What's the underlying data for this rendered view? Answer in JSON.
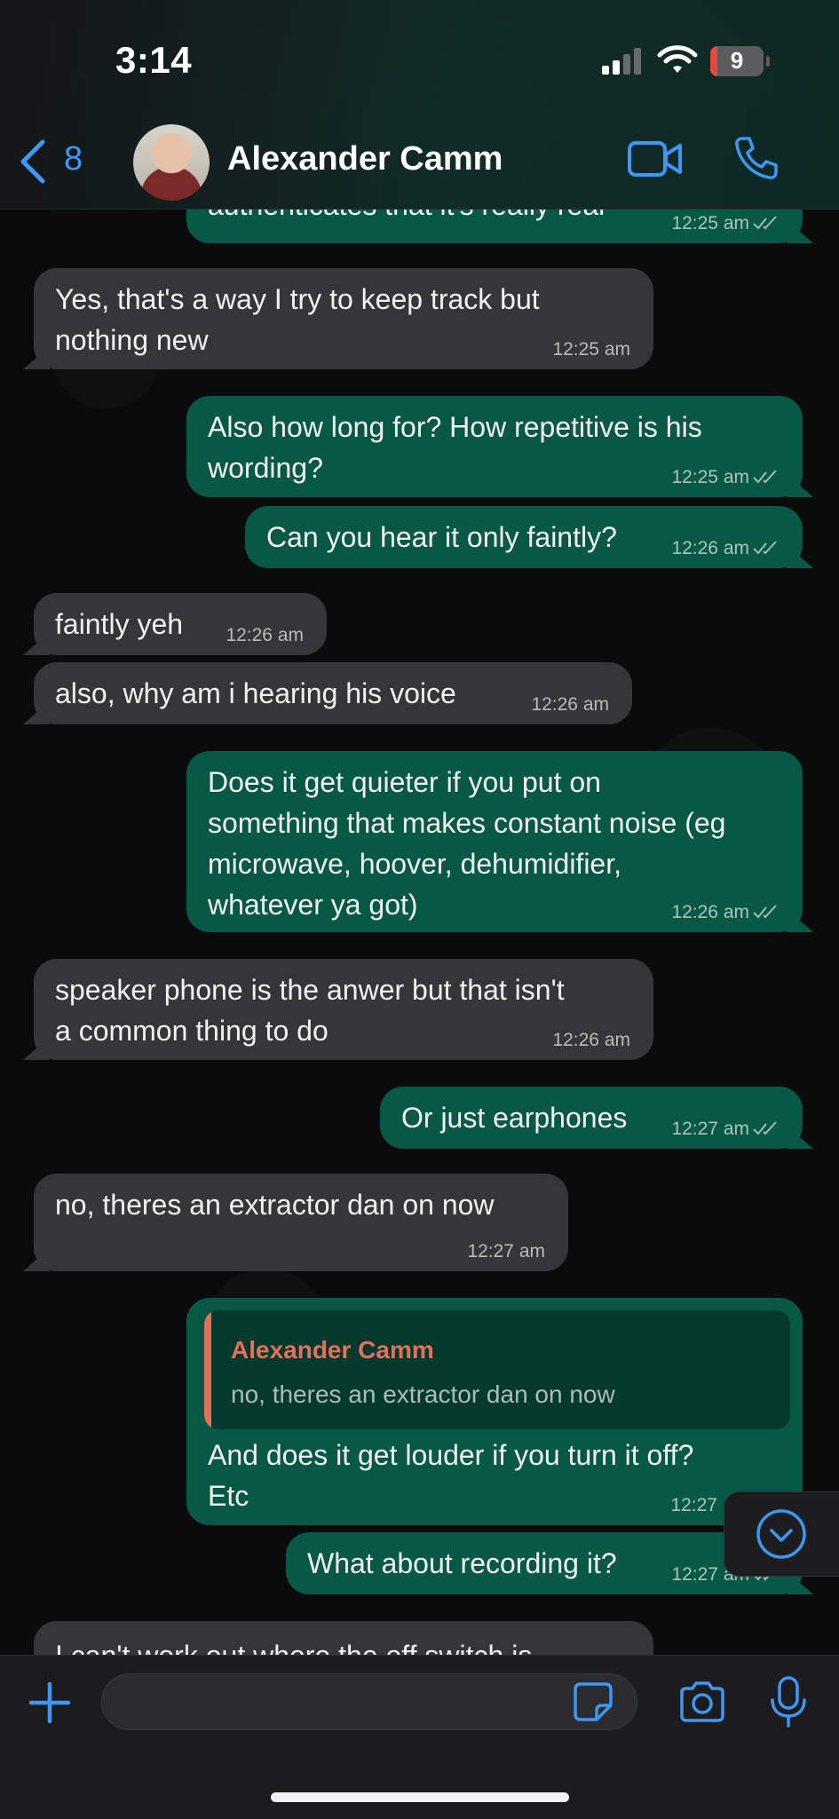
{
  "status_bar": {
    "time": "3:14",
    "battery": "9"
  },
  "header": {
    "back_count": "8",
    "contact_name": "Alexander Camm"
  },
  "messages": [
    {
      "dir": "out",
      "text": "authenticates that it's really real",
      "time": "12:25 am"
    },
    {
      "dir": "in",
      "text": "Yes, that's a way I try to keep track but\nnothing new",
      "time": "12:25 am"
    },
    {
      "dir": "out",
      "text": "Also how long for? How repetitive is his\nwording?",
      "time": "12:25 am"
    },
    {
      "dir": "out",
      "text": "Can you hear it only faintly?",
      "time": "12:26 am"
    },
    {
      "dir": "in",
      "text": "faintly yeh",
      "time": "12:26 am"
    },
    {
      "dir": "in",
      "text": "also, why am i hearing his voice",
      "time": "12:26 am"
    },
    {
      "dir": "out",
      "text": "Does it get quieter if you put on\nsomething that makes constant noise (eg\nmicrowave, hoover, dehumidifier,\nwhatever ya got)",
      "time": "12:26 am"
    },
    {
      "dir": "in",
      "text": "speaker phone is the anwer but that isn't\na common thing to do",
      "time": "12:26 am"
    },
    {
      "dir": "out",
      "text": "Or just earphones",
      "time": "12:27 am"
    },
    {
      "dir": "in",
      "text": "no, theres an extractor dan on now",
      "time": "12:27 am"
    },
    {
      "dir": "out",
      "text": "And does it get louder if you turn it off?\nEtc",
      "time": "12:27",
      "reply_to": {
        "name": "Alexander Camm",
        "text": "no, theres an extractor dan on now"
      }
    },
    {
      "dir": "out",
      "text": "What about recording it?",
      "time": "12:27 am"
    },
    {
      "dir": "in",
      "text": "I can't work out where the off switch is",
      "time": ""
    }
  ],
  "composer": {
    "placeholder": ""
  },
  "colors": {
    "accent": "#3f97f5",
    "outgoing": "#075945",
    "incoming": "#363638",
    "reply_name": "#e5705a"
  }
}
